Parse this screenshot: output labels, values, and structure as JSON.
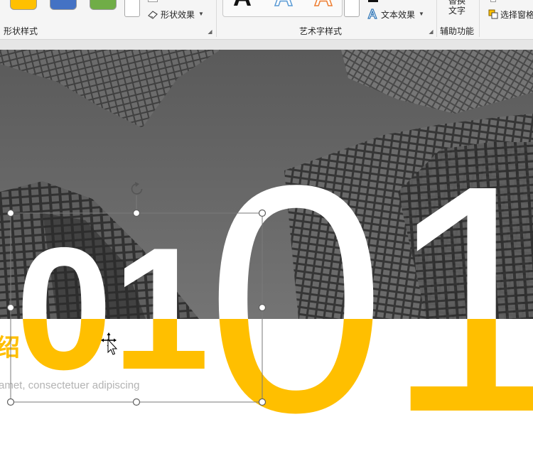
{
  "ribbon": {
    "shape_styles": {
      "group_label": "形状样式",
      "swatch_colors": [
        "#ffc000",
        "#4472c4",
        "#70ad47"
      ],
      "effects_label": "形状效果"
    },
    "wordart_styles": {
      "group_label": "艺术字样式",
      "letters": [
        "A",
        "A",
        "A"
      ],
      "letter_colors": [
        "#111111",
        "#5b9bd5",
        "#ed7d31"
      ],
      "text_effects_label": "文本效果"
    },
    "accessibility": {
      "group_label": "辅助功能",
      "alt_text_label_line1": "替换",
      "alt_text_label_line2": "文字"
    },
    "arrange": {
      "selection_pane_label": "选择窗格"
    }
  },
  "slide": {
    "big_number_left": "01",
    "big_number_right": "01",
    "title_partial": "绍",
    "subtitle_partial": "amet, consectetuer adipiscing",
    "accent_color": "#ffbf00",
    "text_gray": "#b3b3b3"
  }
}
